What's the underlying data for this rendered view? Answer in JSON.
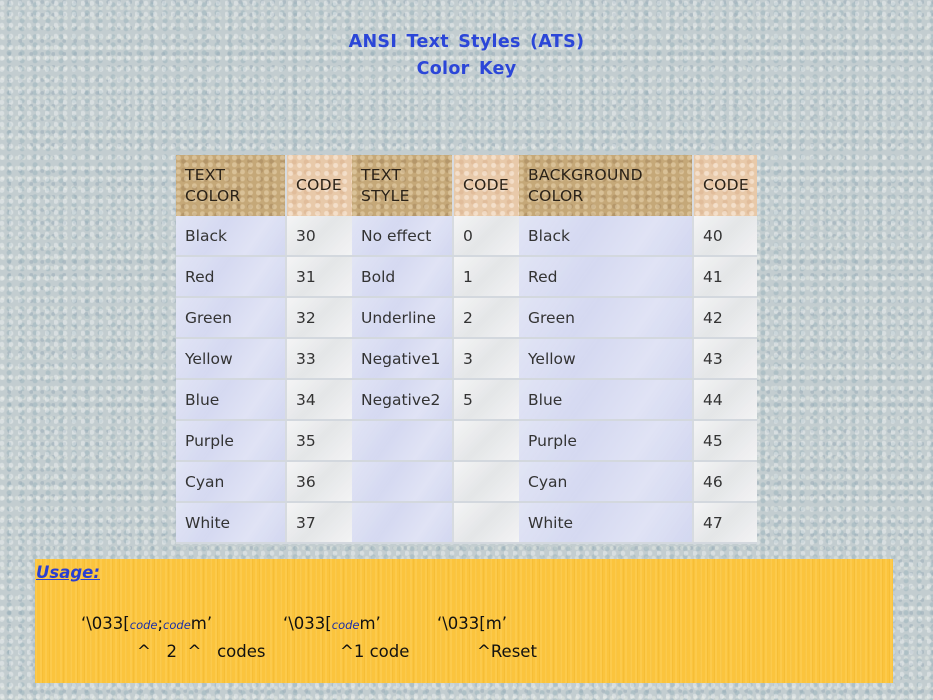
{
  "title": {
    "line1": "ANSI  Text  Styles  (ATS)",
    "line2": "Color Key"
  },
  "table": {
    "headers": [
      "TEXT\nCOLOR",
      "CODE",
      "TEXT\nSTYLE",
      "CODE",
      "BACKGROUND\nCOLOR",
      "CODE"
    ],
    "rows": [
      [
        "Black",
        "30",
        "No effect",
        "0",
        "Black",
        "40"
      ],
      [
        "Red",
        "31",
        "Bold",
        "1",
        "Red",
        "41"
      ],
      [
        "Green",
        "32",
        "Underline",
        "2",
        "Green",
        "42"
      ],
      [
        "Yellow",
        "33",
        "Negative1",
        "3",
        "Yellow",
        "43"
      ],
      [
        "Blue",
        "34",
        "Negative2",
        "5",
        "Blue",
        "44"
      ],
      [
        "Purple",
        "35",
        "",
        "",
        "Purple",
        "45"
      ],
      [
        "Cyan",
        "36",
        "",
        "",
        "Cyan",
        "46"
      ],
      [
        "White",
        "37",
        "",
        "",
        "White",
        "47"
      ]
    ]
  },
  "usage": {
    "label": "Usage:",
    "example1": {
      "prefix": "‘\\033[",
      "code_a": "code",
      "sep": ";",
      "code_b": "code",
      "suffix": "m’"
    },
    "example2": {
      "prefix": "‘\\033[",
      "code": "code",
      "suffix": "m’"
    },
    "example3": {
      "text": "‘\\033[m’"
    },
    "note1": "^   2  ^   codes",
    "note2": "^1 code",
    "note3": "^Reset"
  },
  "colors": {
    "title": "#2b46d8",
    "usage_label": "#2b3fd1",
    "usage_bg": "#fbc43d",
    "header_dark": "#c5a878",
    "header_light": "#e8c9a9",
    "cell_lavender": "#d8dcf2",
    "cell_white": "#ebeced"
  }
}
